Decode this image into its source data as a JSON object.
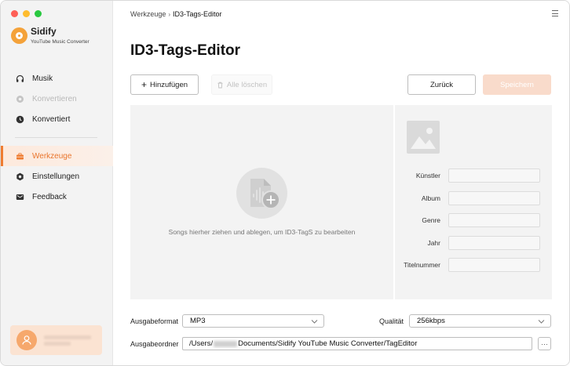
{
  "app": {
    "name": "Sidify",
    "subtitle": "YouTube Music Converter"
  },
  "sidebar": {
    "items": [
      {
        "label": "Musik",
        "icon": "headphones-icon",
        "state": "normal"
      },
      {
        "label": "Konvertieren",
        "icon": "convert-icon",
        "state": "disabled"
      },
      {
        "label": "Konvertiert",
        "icon": "clock-icon",
        "state": "normal"
      },
      {
        "label": "Werkzeuge",
        "icon": "toolbox-icon",
        "state": "active"
      },
      {
        "label": "Einstellungen",
        "icon": "gear-icon",
        "state": "normal"
      },
      {
        "label": "Feedback",
        "icon": "mail-icon",
        "state": "normal"
      }
    ]
  },
  "header": {
    "breadcrumb_root": "Werkzeuge",
    "breadcrumb_separator": "›",
    "breadcrumb_current": "ID3-Tags-Editor",
    "title": "ID3-Tags-Editor"
  },
  "toolbar": {
    "add_label": "Hinzufügen",
    "clear_label": "Alle löschen",
    "back_label": "Zurück",
    "save_label": "Speichern"
  },
  "drop_zone": {
    "text": "Songs hierher ziehen und ablegen, um ID3-TagS zu bearbeiten"
  },
  "tags": {
    "fields": [
      {
        "label": "Künstler",
        "value": ""
      },
      {
        "label": "Album",
        "value": ""
      },
      {
        "label": "Genre",
        "value": ""
      },
      {
        "label": "Jahr",
        "value": ""
      },
      {
        "label": "Titelnummer",
        "value": ""
      }
    ]
  },
  "output": {
    "format_label": "Ausgabeformat",
    "format_value": "MP3",
    "quality_label": "Qualität",
    "quality_value": "256kbps",
    "folder_label": "Ausgabeordner",
    "folder_prefix": "/Users/",
    "folder_suffix": "Documents/Sidify YouTube Music Converter/TagEditor",
    "more_label": "···"
  },
  "colors": {
    "accent": "#ef7c30",
    "active_bg": "#fde9dc",
    "save_disabled": "#f9dbcb"
  }
}
